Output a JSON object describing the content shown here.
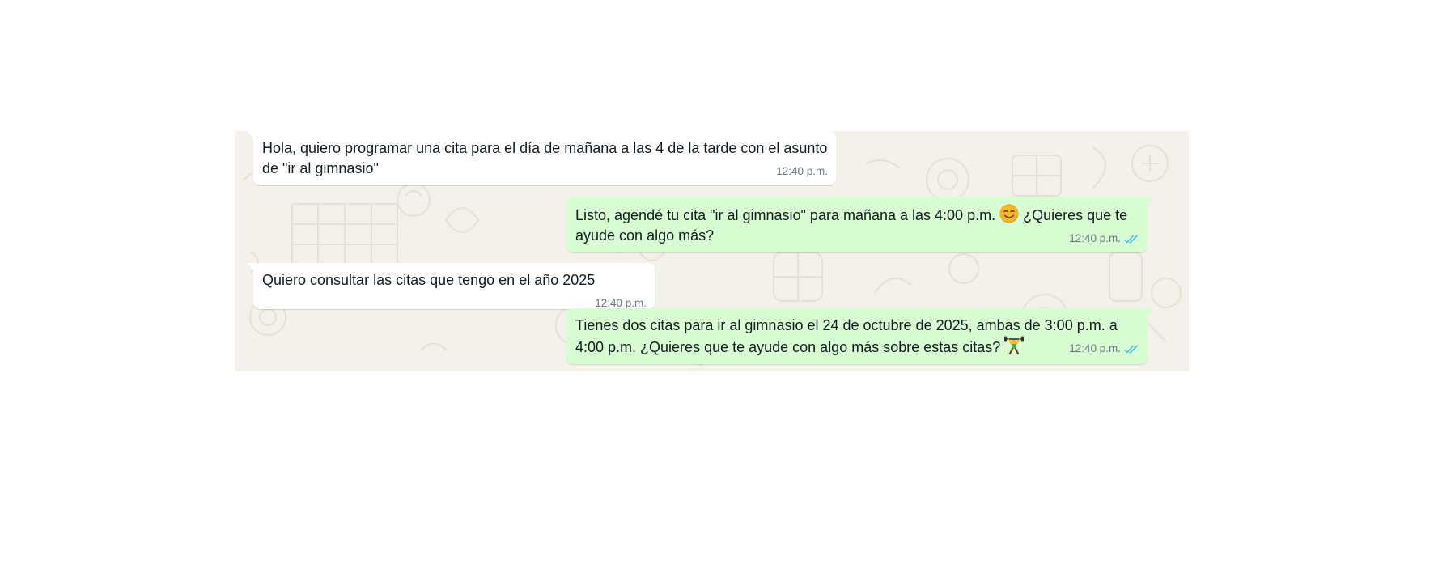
{
  "colors": {
    "incoming_bg": "#ffffff",
    "outgoing_bg": "#d9fdd3",
    "chat_bg": "#f4f0ea",
    "read_ticks": "#53bdeb"
  },
  "messages": [
    {
      "direction": "incoming",
      "text": "Hola, quiero programar una cita para el día de mañana a las 4 de la tarde con el asunto de \"ir al gimnasio\"",
      "time": "12:40 p.m."
    },
    {
      "direction": "outgoing",
      "text_before_emoji": "Listo, agendé tu cita \"ir al gimnasio\" para mañana a las 4:00 p.m.",
      "emoji": "smiling-face-icon",
      "text_after_emoji": "¿Quieres que te ayude con algo más?",
      "time": "12:40 p.m.",
      "status": "read"
    },
    {
      "direction": "incoming",
      "text": "Quiero consultar las citas que tengo en el año 2025",
      "time": "12:40 p.m."
    },
    {
      "direction": "outgoing",
      "text": "Tienes dos citas para ir al gimnasio el 24 de octubre de 2025, ambas de 3:00 p.m. a 4:00 p.m. ¿Quieres que te ayude con algo más sobre estas citas?",
      "emoji": "weightlifter-icon",
      "time": "12:40 p.m.",
      "status": "read"
    }
  ]
}
